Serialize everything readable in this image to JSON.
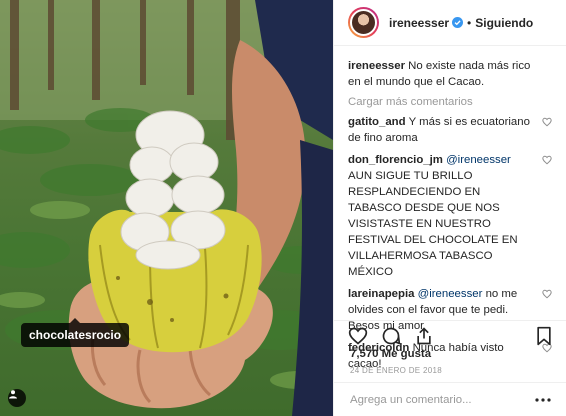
{
  "post": {
    "username": "ireneesser",
    "follow_label": "Siguiendo",
    "separator": "•"
  },
  "photo": {
    "tag_label": "chocolatesrocio"
  },
  "caption": {
    "username": "ireneesser",
    "text": "No existe nada más rico en el mundo que el Cacao."
  },
  "load_more_label": "Cargar más comentarios",
  "comments": [
    {
      "username": "gatito_and",
      "mention": "",
      "text": "Y más si es ecuatoriano de fino aroma"
    },
    {
      "username": "don_florencio_jm",
      "mention": "@ireneesser",
      "text": "AUN SIGUE TU BRILLO RESPLANDECIENDO EN TABASCO DESDE QUE NOS VISISTASTE EN NUESTRO FESTIVAL DEL CHOCOLATE EN VILLAHERMOSA TABASCO MÉXICO"
    },
    {
      "username": "lareinapepia",
      "mention": "@ireneesser",
      "text": "no me olvides con el favor que te pedi. Besos mi amor"
    },
    {
      "username": "federicoldn",
      "mention": "",
      "text": "Nunca había visto cacao!"
    }
  ],
  "likes_label": "7,570 Me gusta",
  "date_label": "24 DE ENERO DE 2018",
  "add_comment_placeholder": "Agrega un comentario...",
  "icons": {
    "verified": "verified-badge-icon",
    "like": "heart-outline-icon",
    "comment": "speech-bubble-icon",
    "share": "share-upload-icon",
    "save": "bookmark-icon",
    "options": "more-dots-icon",
    "tag": "person-tag-icon"
  },
  "colors": {
    "verified": "#3897f0",
    "mention": "#003569",
    "muted": "#999999"
  }
}
